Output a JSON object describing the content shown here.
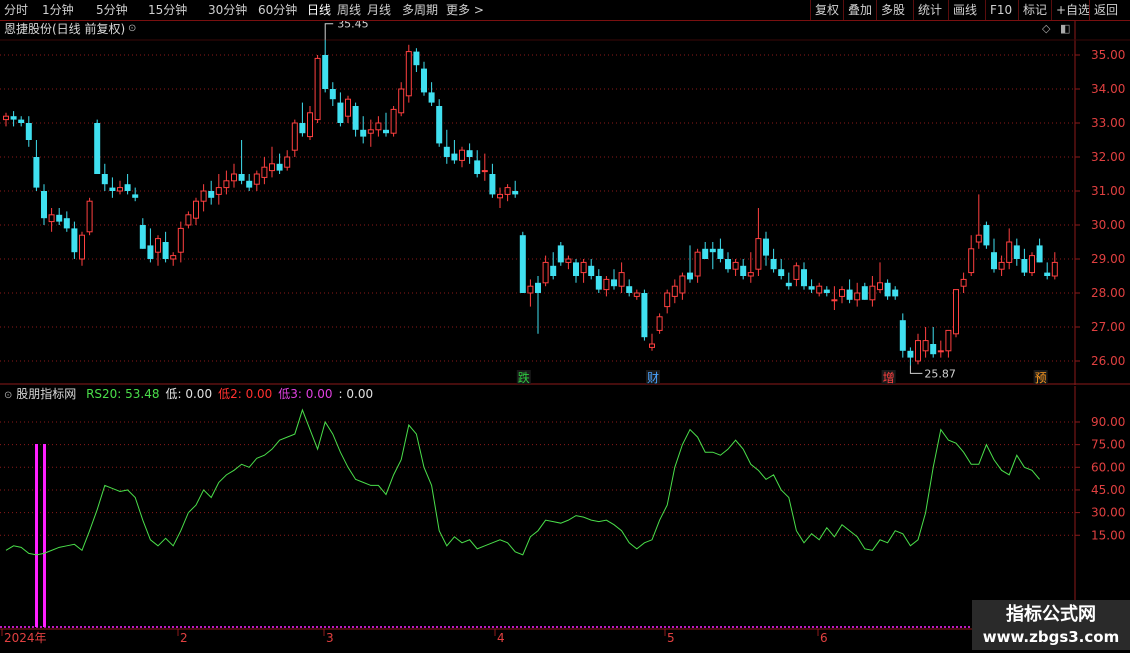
{
  "toolbar": {
    "left": [
      {
        "label": "分时",
        "active": false
      },
      {
        "label": "1分钟",
        "active": false
      },
      {
        "label": "5分钟",
        "active": false
      },
      {
        "label": "15分钟",
        "active": false
      },
      {
        "label": "30分钟",
        "active": false
      },
      {
        "label": "60分钟",
        "active": false
      },
      {
        "label": "日线",
        "active": true
      },
      {
        "label": "周线",
        "active": false
      },
      {
        "label": "月线",
        "active": false
      },
      {
        "label": "多周期",
        "active": false
      },
      {
        "label": "更多 >",
        "active": false
      }
    ],
    "right": [
      "复权",
      "叠加",
      "多股",
      "统计",
      "画线",
      "F10",
      "标记",
      "+自选",
      "返回"
    ]
  },
  "main": {
    "title": "恩捷股份(日线 前复权)",
    "high_label": "35.45",
    "low_label": "25.87",
    "price_axis": [
      "35.00",
      "34.00",
      "33.00",
      "32.00",
      "31.00",
      "30.00",
      "29.00",
      "28.00",
      "27.00",
      "26.00"
    ],
    "markers": [
      {
        "text": "跌",
        "color": "#2ecc40"
      },
      {
        "text": "财",
        "color": "#4aa3ff"
      },
      {
        "text": "增",
        "color": "#ff4040"
      },
      {
        "text": "预",
        "color": "#ff9a1f"
      }
    ]
  },
  "indicator": {
    "name": "股朋指标网",
    "legend": [
      {
        "label": "RS20: 53.48",
        "color": "#4ade4a"
      },
      {
        "label": "低: 0.00",
        "color": "#e0e0e0"
      },
      {
        "label": "低2: 0.00",
        "color": "#ff3030"
      },
      {
        "label": "低3: 0.00",
        "color": "#e040e0"
      },
      {
        "label": ": 0.00",
        "color": "#e0e0e0"
      }
    ],
    "axis": [
      "90.00",
      "75.00",
      "60.00",
      "45.00",
      "30.00",
      "15.00"
    ]
  },
  "date_axis": [
    "2024年",
    "2",
    "3",
    "4",
    "5",
    "6"
  ],
  "watermark": {
    "line1": "指标公式网",
    "line2": "www.zbgs3.com"
  },
  "colors": {
    "up": "#ff4040",
    "down": "#40e0f0",
    "grid": "#8b1a1a",
    "rs": "#4ade4a",
    "pink": "#ff20ff"
  },
  "chart_data": {
    "type": "candlestick",
    "candles": [
      [
        33.1,
        33.3,
        32.9,
        33.2
      ],
      [
        33.2,
        33.35,
        32.9,
        33.1
      ],
      [
        33.1,
        33.2,
        32.9,
        33.0
      ],
      [
        33.0,
        33.2,
        32.3,
        32.5
      ],
      [
        32.0,
        32.5,
        31.0,
        31.1
      ],
      [
        31.0,
        31.2,
        30.0,
        30.2
      ],
      [
        30.1,
        30.5,
        29.8,
        30.3
      ],
      [
        30.3,
        30.5,
        30.0,
        30.1
      ],
      [
        30.2,
        30.4,
        29.8,
        29.9
      ],
      [
        29.9,
        30.1,
        29.0,
        29.2
      ],
      [
        29.0,
        29.8,
        28.8,
        29.7
      ],
      [
        29.8,
        30.8,
        29.7,
        30.7
      ],
      [
        33.0,
        33.1,
        31.5,
        31.5
      ],
      [
        31.5,
        31.8,
        31.0,
        31.2
      ],
      [
        31.1,
        31.4,
        30.8,
        31.0
      ],
      [
        31.0,
        31.3,
        30.9,
        31.1
      ],
      [
        31.2,
        31.5,
        30.9,
        31.0
      ],
      [
        30.9,
        31.1,
        30.7,
        30.8
      ],
      [
        30.0,
        30.2,
        29.3,
        29.3
      ],
      [
        29.4,
        29.9,
        28.9,
        29.0
      ],
      [
        29.2,
        29.7,
        28.8,
        29.6
      ],
      [
        29.5,
        29.8,
        28.9,
        29.0
      ],
      [
        29.0,
        29.2,
        28.8,
        29.1
      ],
      [
        29.2,
        30.1,
        28.9,
        29.9
      ],
      [
        30.0,
        30.4,
        29.9,
        30.3
      ],
      [
        30.2,
        30.8,
        30.0,
        30.7
      ],
      [
        30.7,
        31.2,
        30.4,
        31.0
      ],
      [
        31.0,
        31.3,
        30.6,
        30.8
      ],
      [
        30.9,
        31.5,
        30.6,
        31.1
      ],
      [
        31.1,
        31.6,
        30.9,
        31.3
      ],
      [
        31.3,
        31.8,
        31.1,
        31.5
      ],
      [
        31.5,
        32.5,
        31.2,
        31.3
      ],
      [
        31.3,
        31.5,
        31.0,
        31.1
      ],
      [
        31.2,
        31.6,
        31.0,
        31.5
      ],
      [
        31.4,
        32.0,
        31.2,
        31.7
      ],
      [
        31.6,
        32.3,
        31.4,
        31.8
      ],
      [
        31.8,
        32.1,
        31.5,
        31.6
      ],
      [
        31.7,
        32.2,
        31.6,
        32.0
      ],
      [
        32.2,
        33.1,
        32.0,
        33.0
      ],
      [
        33.0,
        33.6,
        32.6,
        32.7
      ],
      [
        32.6,
        33.5,
        32.5,
        33.3
      ],
      [
        33.1,
        35.0,
        33.0,
        34.9
      ],
      [
        35.0,
        35.45,
        33.9,
        34.0
      ],
      [
        34.0,
        34.2,
        33.5,
        33.7
      ],
      [
        33.6,
        33.9,
        32.9,
        33.0
      ],
      [
        33.2,
        33.8,
        33.0,
        33.7
      ],
      [
        33.5,
        33.6,
        32.6,
        32.8
      ],
      [
        32.8,
        33.2,
        32.4,
        32.6
      ],
      [
        32.7,
        33.1,
        32.3,
        32.8
      ],
      [
        32.8,
        33.2,
        32.6,
        33.0
      ],
      [
        32.8,
        33.3,
        32.6,
        32.7
      ],
      [
        32.7,
        33.5,
        32.6,
        33.4
      ],
      [
        33.3,
        34.2,
        33.2,
        34.0
      ],
      [
        33.8,
        35.3,
        33.6,
        35.1
      ],
      [
        35.1,
        35.2,
        34.5,
        34.7
      ],
      [
        34.6,
        34.8,
        33.8,
        33.9
      ],
      [
        33.9,
        34.2,
        33.5,
        33.6
      ],
      [
        33.5,
        33.7,
        32.3,
        32.4
      ],
      [
        32.3,
        32.8,
        31.8,
        32.0
      ],
      [
        32.1,
        32.5,
        31.8,
        31.9
      ],
      [
        31.9,
        32.3,
        31.7,
        32.2
      ],
      [
        32.2,
        32.4,
        31.8,
        32.0
      ],
      [
        31.9,
        32.2,
        31.4,
        31.5
      ],
      [
        31.6,
        32.1,
        31.3,
        31.6
      ],
      [
        31.5,
        31.8,
        30.8,
        30.9
      ],
      [
        30.8,
        31.1,
        30.5,
        30.9
      ],
      [
        30.9,
        31.2,
        30.7,
        31.1
      ],
      [
        31.0,
        31.3,
        30.8,
        30.9
      ],
      [
        29.7,
        29.8,
        28.0,
        28.0
      ],
      [
        28.0,
        28.4,
        27.6,
        28.2
      ],
      [
        28.3,
        28.5,
        26.8,
        28.0
      ],
      [
        28.3,
        29.1,
        28.2,
        28.9
      ],
      [
        28.8,
        29.2,
        28.4,
        28.5
      ],
      [
        29.4,
        29.5,
        28.8,
        28.9
      ],
      [
        28.9,
        29.1,
        28.7,
        29.0
      ],
      [
        28.9,
        29.0,
        28.3,
        28.5
      ],
      [
        28.6,
        29.0,
        28.3,
        28.9
      ],
      [
        28.8,
        29.0,
        28.4,
        28.5
      ],
      [
        28.5,
        28.7,
        28.0,
        28.1
      ],
      [
        28.1,
        28.5,
        27.9,
        28.4
      ],
      [
        28.4,
        28.7,
        28.1,
        28.2
      ],
      [
        28.2,
        28.9,
        28.0,
        28.6
      ],
      [
        28.2,
        28.4,
        27.9,
        28.0
      ],
      [
        27.9,
        28.1,
        27.8,
        28.0
      ],
      [
        28.0,
        28.1,
        26.6,
        26.7
      ],
      [
        26.4,
        26.8,
        26.3,
        26.5
      ],
      [
        26.9,
        27.4,
        26.8,
        27.3
      ],
      [
        27.6,
        28.1,
        27.4,
        28.0
      ],
      [
        27.9,
        28.4,
        27.7,
        28.2
      ],
      [
        28.0,
        28.6,
        27.8,
        28.5
      ],
      [
        28.6,
        29.4,
        28.3,
        28.4
      ],
      [
        28.5,
        29.3,
        28.3,
        29.2
      ],
      [
        29.3,
        29.5,
        29.0,
        29.0
      ],
      [
        29.3,
        29.5,
        28.7,
        29.2
      ],
      [
        29.3,
        29.6,
        28.9,
        29.0
      ],
      [
        29.0,
        29.2,
        28.6,
        28.7
      ],
      [
        28.7,
        29.0,
        28.5,
        28.9
      ],
      [
        28.8,
        29.0,
        28.4,
        28.5
      ],
      [
        28.5,
        29.2,
        28.3,
        28.6
      ],
      [
        28.7,
        30.5,
        28.5,
        29.6
      ],
      [
        29.6,
        29.8,
        28.8,
        29.1
      ],
      [
        29.0,
        29.3,
        28.6,
        28.7
      ],
      [
        28.7,
        29.0,
        28.4,
        28.5
      ],
      [
        28.3,
        28.6,
        28.1,
        28.2
      ],
      [
        28.4,
        28.9,
        28.2,
        28.8
      ],
      [
        28.7,
        28.9,
        28.1,
        28.2
      ],
      [
        28.2,
        28.4,
        28.0,
        28.1
      ],
      [
        28.0,
        28.3,
        27.9,
        28.2
      ],
      [
        28.1,
        28.2,
        27.9,
        28.0
      ],
      [
        27.8,
        28.2,
        27.5,
        27.8
      ],
      [
        27.9,
        28.2,
        27.7,
        28.1
      ],
      [
        28.1,
        28.4,
        27.7,
        27.8
      ],
      [
        27.8,
        28.3,
        27.6,
        28.0
      ],
      [
        28.2,
        28.3,
        27.8,
        27.8
      ],
      [
        27.8,
        28.5,
        27.6,
        28.2
      ],
      [
        28.1,
        28.9,
        28.0,
        28.3
      ],
      [
        28.3,
        28.4,
        27.8,
        27.9
      ],
      [
        28.1,
        28.2,
        27.8,
        27.9
      ],
      [
        27.2,
        27.4,
        26.1,
        26.3
      ],
      [
        26.3,
        26.4,
        25.87,
        26.1
      ],
      [
        26.0,
        26.8,
        25.9,
        26.6
      ],
      [
        26.3,
        27.0,
        26.1,
        26.6
      ],
      [
        26.5,
        27.0,
        26.1,
        26.2
      ],
      [
        26.3,
        26.6,
        26.1,
        26.3
      ],
      [
        26.3,
        26.9,
        26.1,
        26.9
      ],
      [
        26.8,
        28.1,
        26.7,
        28.1
      ],
      [
        28.2,
        28.6,
        28.0,
        28.4
      ],
      [
        28.6,
        29.7,
        28.5,
        29.3
      ],
      [
        29.5,
        30.9,
        29.3,
        29.7
      ],
      [
        30.0,
        30.1,
        29.3,
        29.4
      ],
      [
        29.2,
        29.6,
        28.6,
        28.7
      ],
      [
        28.7,
        29.1,
        28.5,
        28.9
      ],
      [
        28.9,
        29.9,
        28.7,
        29.5
      ],
      [
        29.4,
        29.6,
        28.8,
        29.0
      ],
      [
        29.0,
        29.3,
        28.5,
        28.6
      ],
      [
        28.6,
        29.2,
        28.5,
        29.1
      ],
      [
        29.4,
        29.6,
        28.9,
        28.9
      ],
      [
        28.6,
        28.9,
        28.4,
        28.5
      ],
      [
        28.5,
        29.2,
        28.4,
        28.9
      ]
    ],
    "rs20": [
      5,
      8,
      7,
      3,
      2,
      3,
      5,
      7,
      8,
      9,
      5,
      18,
      32,
      48,
      46,
      44,
      45,
      40,
      25,
      12,
      8,
      13,
      8,
      18,
      30,
      35,
      45,
      40,
      50,
      55,
      58,
      62,
      60,
      66,
      68,
      72,
      78,
      80,
      82,
      98,
      85,
      72,
      90,
      82,
      70,
      60,
      52,
      50,
      48,
      48,
      42,
      55,
      65,
      88,
      82,
      60,
      48,
      18,
      8,
      14,
      10,
      12,
      6,
      8,
      10,
      12,
      10,
      4,
      2,
      14,
      18,
      25,
      24,
      23,
      25,
      28,
      27,
      25,
      24,
      25,
      22,
      18,
      10,
      6,
      10,
      12,
      25,
      35,
      60,
      75,
      85,
      80,
      70,
      70,
      68,
      72,
      78,
      72,
      62,
      58,
      52,
      55,
      45,
      40,
      18,
      10,
      16,
      12,
      20,
      14,
      22,
      18,
      14,
      6,
      5,
      12,
      10,
      18,
      16,
      8,
      12,
      30,
      60,
      85,
      78,
      76,
      70,
      62,
      62,
      75,
      65,
      58,
      55,
      68,
      60,
      58,
      52
    ]
  }
}
